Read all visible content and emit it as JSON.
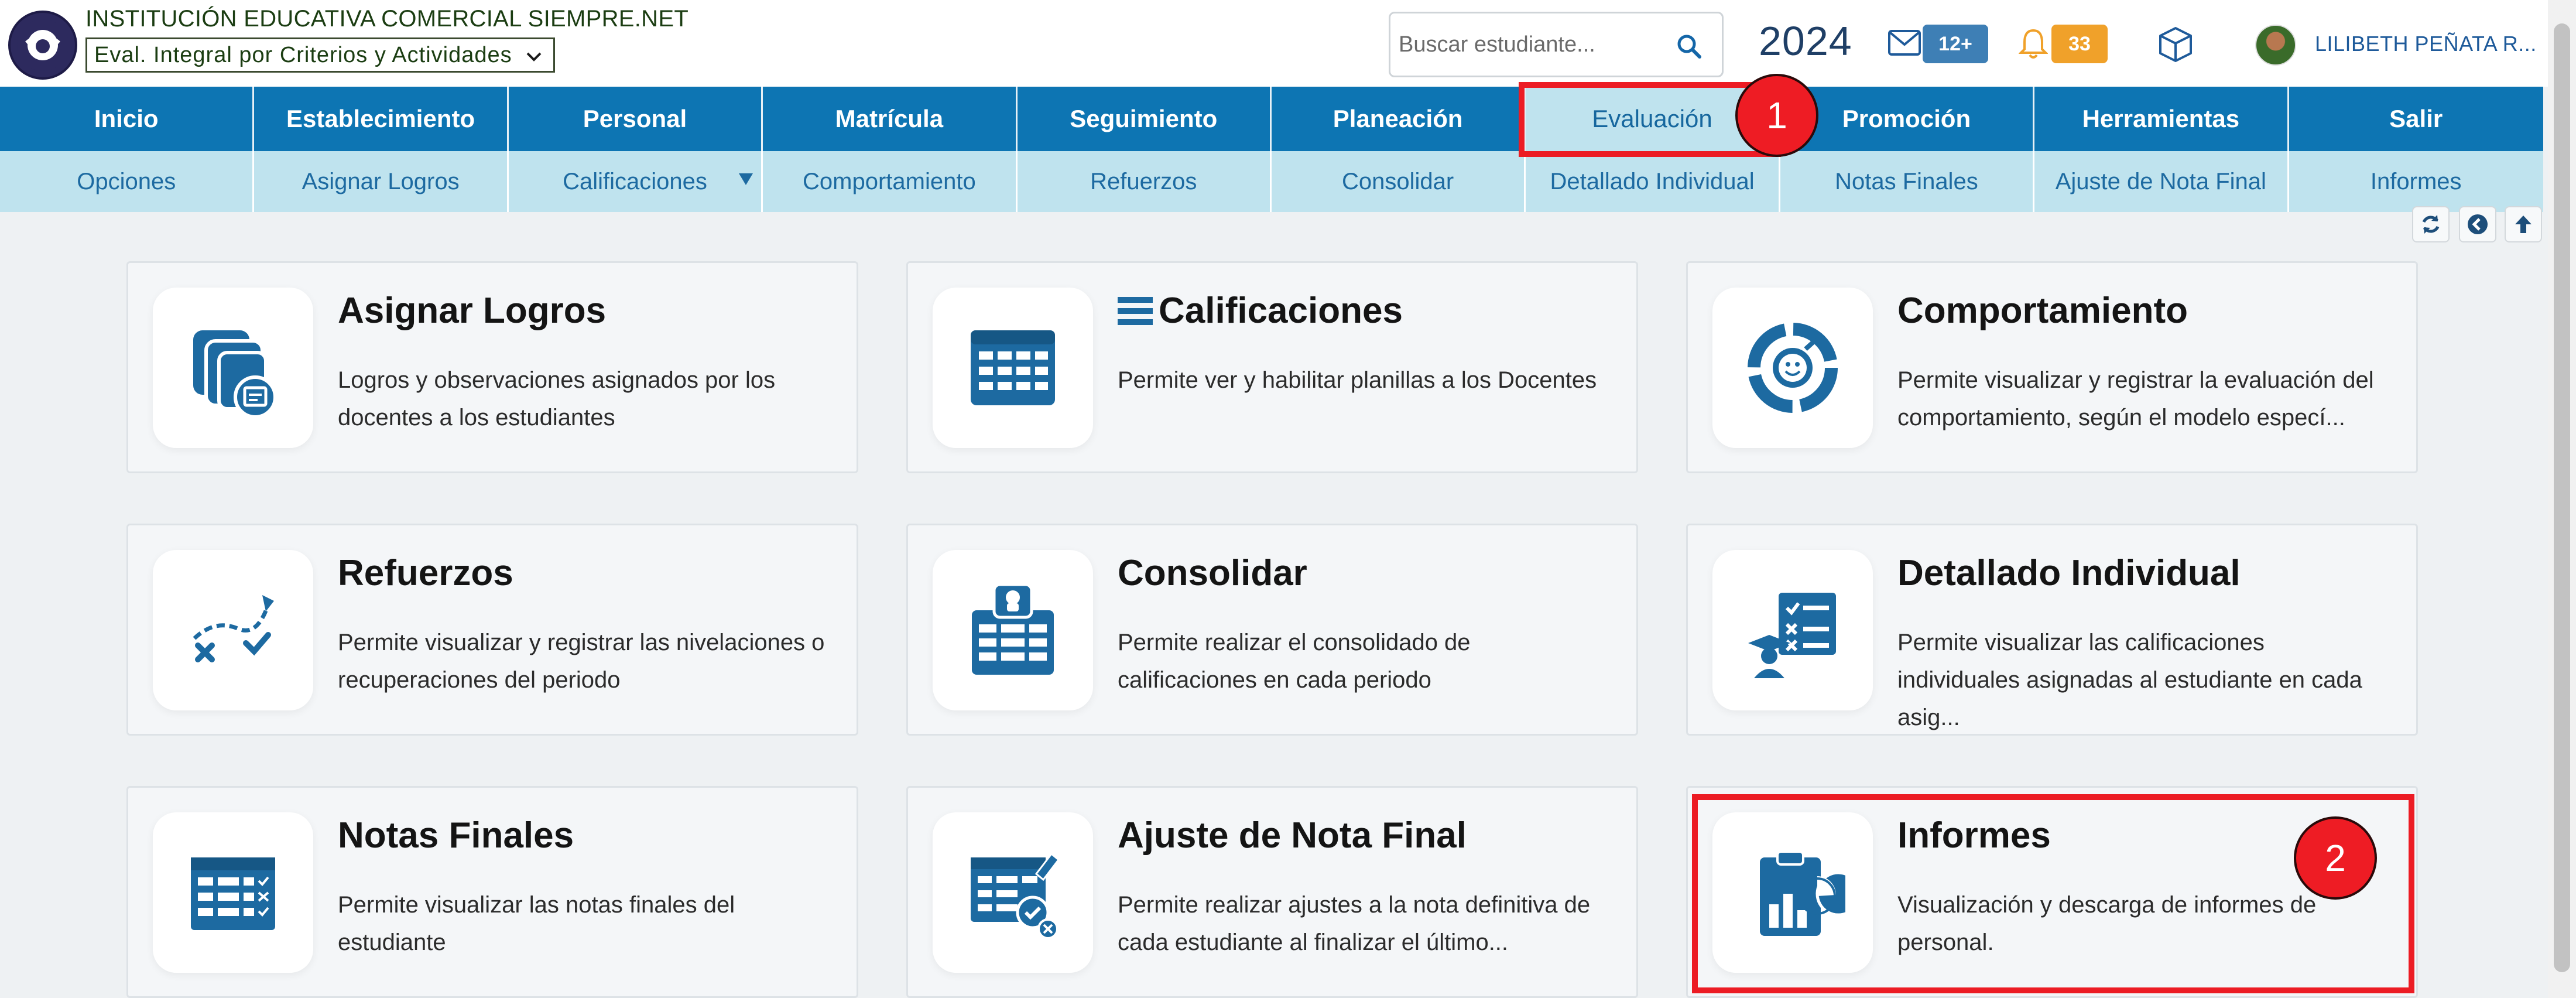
{
  "header": {
    "school_name": "INSTITUCIÓN EDUCATIVA COMERCIAL SIEMPRE.NET",
    "eval_select": "Eval. Integral por Criterios y Actividades",
    "search_placeholder": "Buscar estudiante...",
    "year": "2024",
    "mail_badge": "12+",
    "bell_badge": "33",
    "user_name": "LILIBETH PEÑATA R...",
    "colors": {
      "mail_badge": "#3e7fb5",
      "bell_badge": "#f0a12a"
    }
  },
  "main_nav": [
    {
      "label": "Inicio"
    },
    {
      "label": "Establecimiento"
    },
    {
      "label": "Personal"
    },
    {
      "label": "Matrícula"
    },
    {
      "label": "Seguimiento"
    },
    {
      "label": "Planeación"
    },
    {
      "label": "Evaluación",
      "active": true
    },
    {
      "label": "Promoción"
    },
    {
      "label": "Herramientas"
    },
    {
      "label": "Salir"
    }
  ],
  "sub_nav": [
    {
      "label": "Opciones"
    },
    {
      "label": "Asignar Logros"
    },
    {
      "label": "Calificaciones",
      "has_dropdown": true
    },
    {
      "label": "Comportamiento"
    },
    {
      "label": "Refuerzos"
    },
    {
      "label": "Consolidar"
    },
    {
      "label": "Detallado Individual"
    },
    {
      "label": "Notas Finales"
    },
    {
      "label": "Ajuste de Nota Final"
    },
    {
      "label": "Informes"
    }
  ],
  "tools": [
    "refresh-icon",
    "back-icon",
    "up-arrow-icon"
  ],
  "cards": [
    {
      "title": "Asignar Logros",
      "desc": "Logros y observaciones asignados por los docentes a los estudiantes",
      "icon": "achievements-icon"
    },
    {
      "title": "Calificaciones",
      "desc": "Permite ver y habilitar planillas a los Docentes",
      "icon": "grades-table-icon"
    },
    {
      "title": "Comportamiento",
      "desc": "Permite visualizar y registrar la evaluación del comportamiento, según el modelo especí...",
      "icon": "behavior-icon"
    },
    {
      "title": "Refuerzos",
      "desc": "Permite visualizar y registrar las nivelaciones o recuperaciones del periodo",
      "icon": "reinforcement-icon"
    },
    {
      "title": "Consolidar",
      "desc": "Permite realizar el consolidado de calificaciones en cada periodo",
      "icon": "consolidate-icon"
    },
    {
      "title": "Detallado Individual",
      "desc": "Permite visualizar las calificaciones individuales asignadas al estudiante en cada asig...",
      "icon": "individual-detail-icon"
    },
    {
      "title": "Notas Finales",
      "desc": "Permite visualizar las notas finales del estudiante",
      "icon": "final-grades-icon"
    },
    {
      "title": "Ajuste de Nota Final",
      "desc": "Permite realizar ajustes a la nota definitiva de cada estudiante al finalizar el último...",
      "icon": "grade-adjust-icon"
    },
    {
      "title": "Informes",
      "desc": "Visualización y descarga de informes de personal.",
      "icon": "reports-icon"
    }
  ],
  "annotations": [
    {
      "label": "1",
      "target": "Evaluación"
    },
    {
      "label": "2",
      "target": "Informes"
    }
  ],
  "accent_color": "#0d75b3",
  "icon_color": "#1d6aa1"
}
